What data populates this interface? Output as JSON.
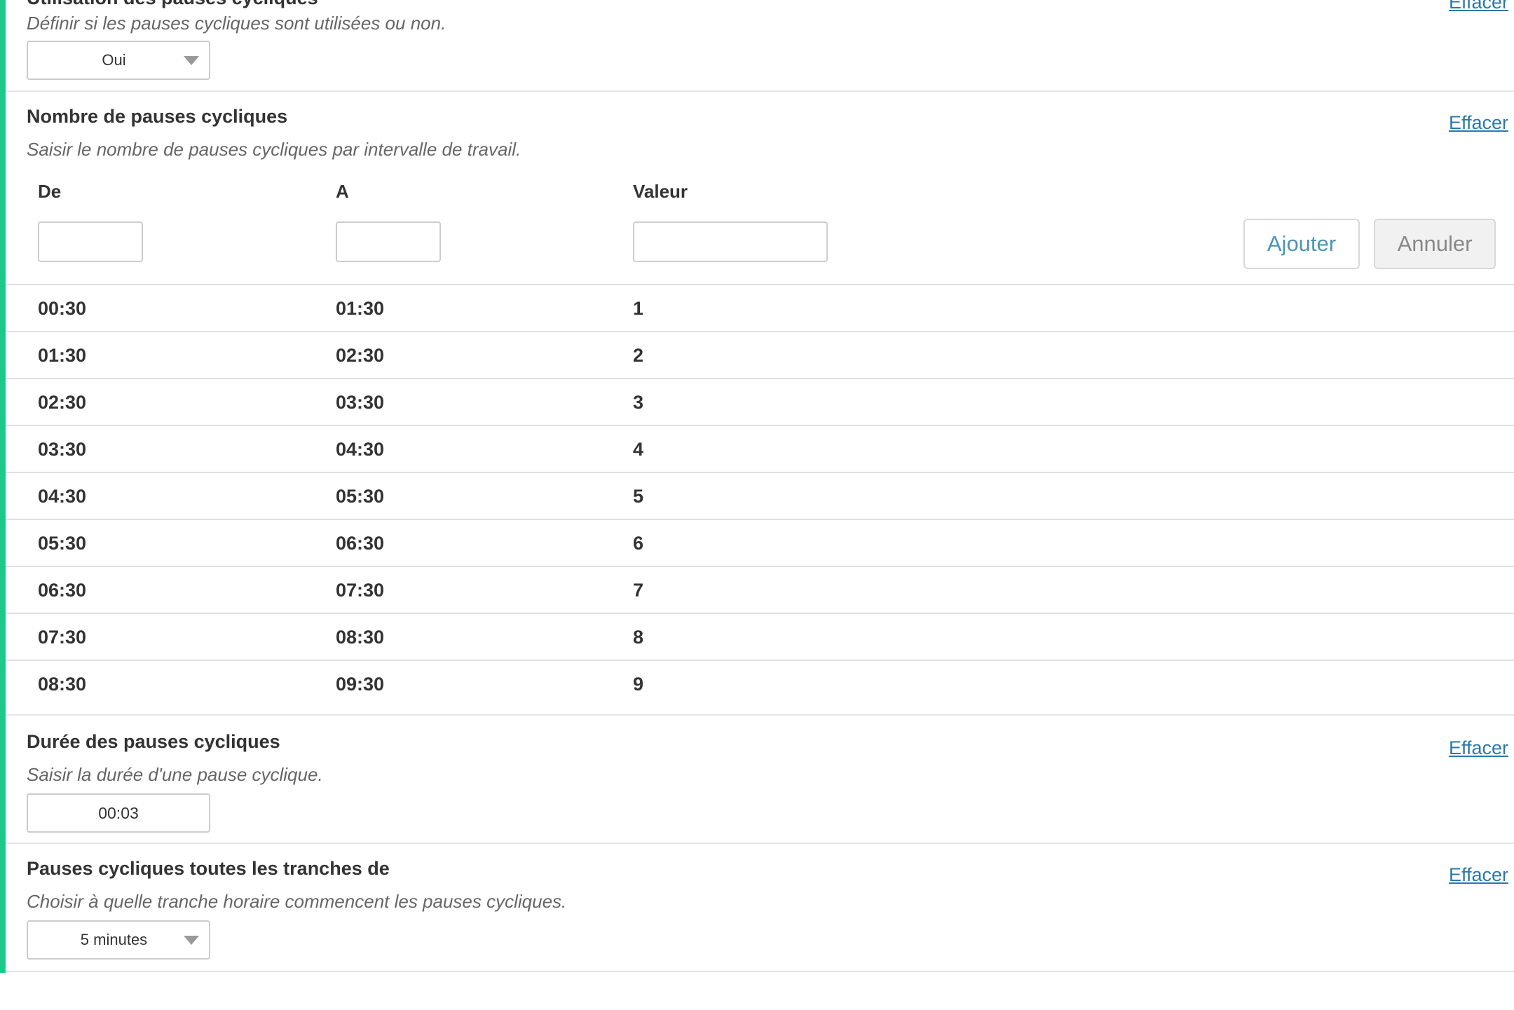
{
  "sections": {
    "usage": {
      "title": "Utilisation des pauses cycliques",
      "description": "Définir si les pauses cycliques sont utilisées ou non.",
      "clear_label": "Effacer",
      "select_value": "Oui"
    },
    "count": {
      "title": "Nombre de pauses cycliques",
      "description": "Saisir le nombre de pauses cycliques par intervalle de travail.",
      "clear_label": "Effacer",
      "columns": {
        "from": "De",
        "to": "A",
        "value": "Valeur"
      },
      "inputs": {
        "from": "",
        "to": "",
        "value": ""
      },
      "add_label": "Ajouter",
      "cancel_label": "Annuler",
      "rows": [
        {
          "from": "00:30",
          "to": "01:30",
          "value": "1"
        },
        {
          "from": "01:30",
          "to": "02:30",
          "value": "2"
        },
        {
          "from": "02:30",
          "to": "03:30",
          "value": "3"
        },
        {
          "from": "03:30",
          "to": "04:30",
          "value": "4"
        },
        {
          "from": "04:30",
          "to": "05:30",
          "value": "5"
        },
        {
          "from": "05:30",
          "to": "06:30",
          "value": "6"
        },
        {
          "from": "06:30",
          "to": "07:30",
          "value": "7"
        },
        {
          "from": "07:30",
          "to": "08:30",
          "value": "8"
        },
        {
          "from": "08:30",
          "to": "09:30",
          "value": "9"
        }
      ]
    },
    "duration": {
      "title": "Durée des pauses cycliques",
      "description": "Saisir la durée d'une pause cyclique.",
      "clear_label": "Effacer",
      "value": "00:03"
    },
    "slice": {
      "title": "Pauses cycliques toutes les tranches de",
      "description": "Choisir à quelle tranche horaire commencent les pauses cycliques.",
      "clear_label": "Effacer",
      "select_value": "5 minutes"
    }
  },
  "colors": {
    "accent_bar": "#1ec78a",
    "link": "#2a7aa8",
    "add_button_text": "#4a95b6"
  }
}
